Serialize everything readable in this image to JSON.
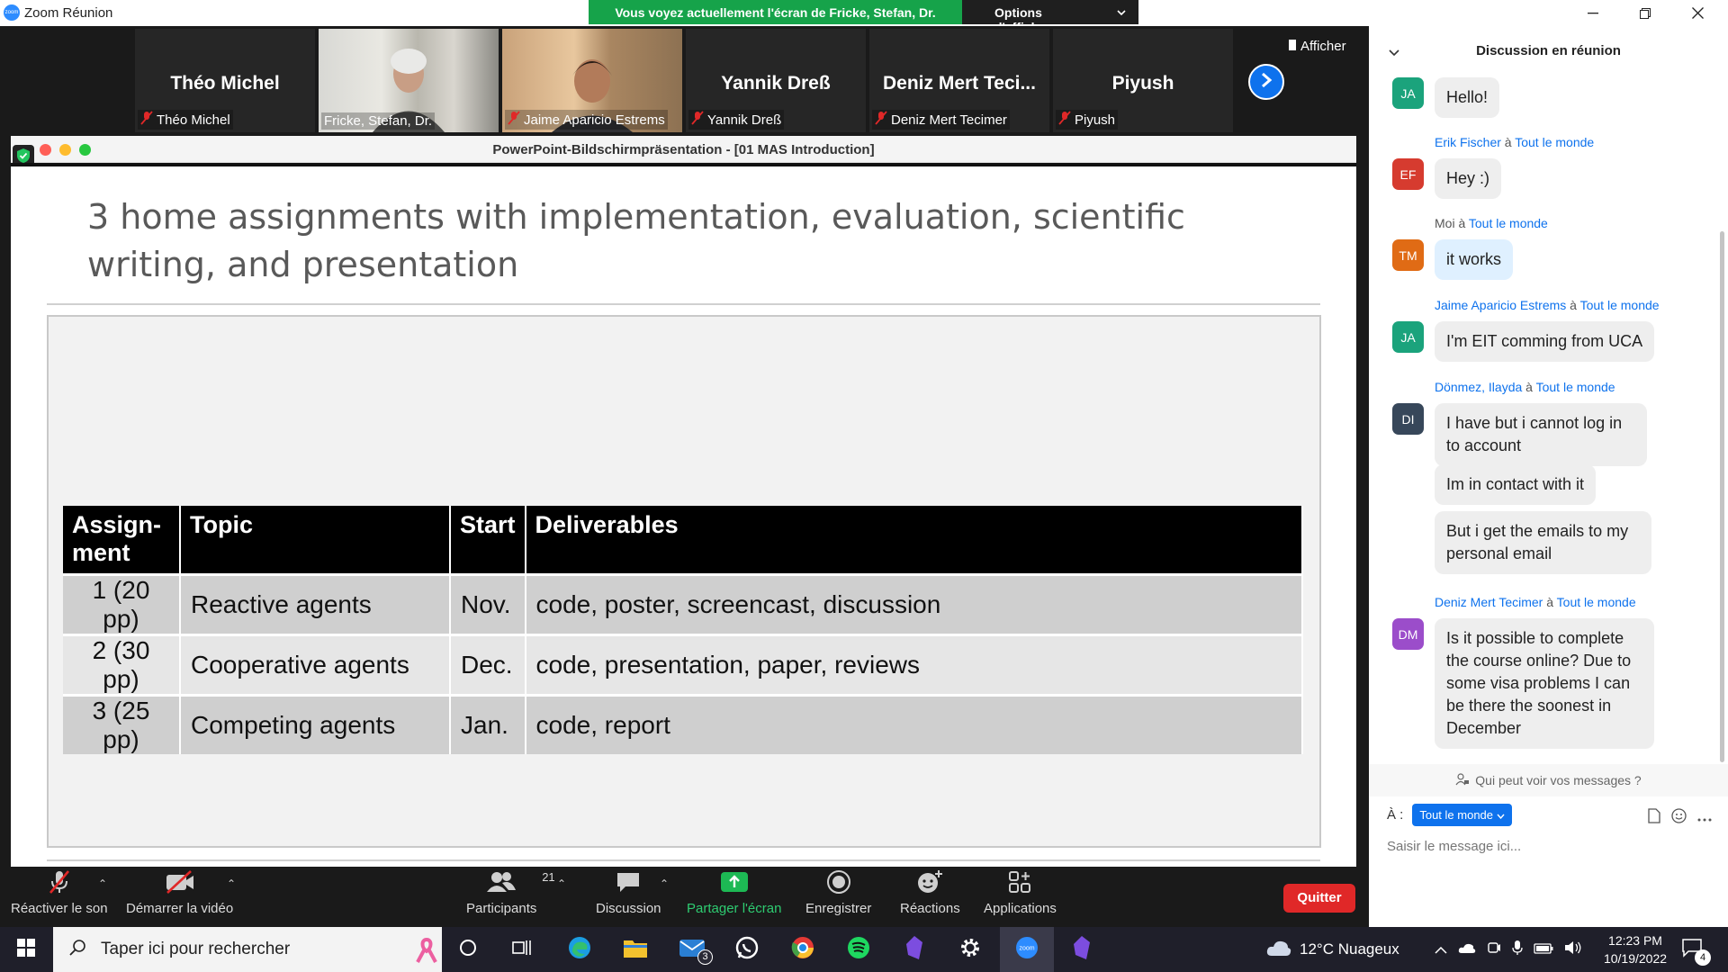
{
  "window": {
    "title": "Zoom Réunion"
  },
  "banner": {
    "viewing": "Vous voyez actuellement l'écran de Fricke, Stefan, Dr.",
    "options": "Options d'affichage"
  },
  "gallery": {
    "show_label": "Afficher",
    "participants": [
      {
        "big_name": "Théo Michel",
        "name": "Théo Michel",
        "muted": true,
        "video": false
      },
      {
        "big_name": "",
        "name": "Fricke, Stefan, Dr.",
        "muted": false,
        "video": true
      },
      {
        "big_name": "",
        "name": "Jaime Aparicio Estrems",
        "muted": true,
        "video": true
      },
      {
        "big_name": "Yannik Dreß",
        "name": "Yannik Dreß",
        "muted": true,
        "video": false
      },
      {
        "big_name": "Deniz Mert Teci...",
        "name": "Deniz Mert Tecimer",
        "muted": true,
        "video": false
      },
      {
        "big_name": "Piyush",
        "name": "Piyush",
        "muted": true,
        "video": false
      }
    ]
  },
  "share": {
    "window_title": "PowerPoint-Bildschirmpräsentation - [01 MAS Introduction]",
    "slide_title": "3 home assignments with implementation, evaluation, scientific writing, and presentation",
    "table": {
      "headers": [
        "Assign-\nment",
        "Topic",
        "Start",
        "Deliverables"
      ],
      "rows": [
        [
          "1 (20 pp)",
          "Reactive agents",
          "Nov.",
          "code, poster, screencast, discussion"
        ],
        [
          "2 (30 pp)",
          "Cooperative agents",
          "Dec.",
          "code, presentation, paper, reviews"
        ],
        [
          "3 (25 pp)",
          "Competing agents",
          "Jan.",
          "code, report"
        ]
      ]
    }
  },
  "toolbar": {
    "unmute": "Réactiver le son",
    "start_video": "Démarrer la vidéo",
    "participants": "Participants",
    "participants_count": "21",
    "chat": "Discussion",
    "share": "Partager l'écran",
    "record": "Enregistrer",
    "reactions": "Réactions",
    "apps": "Applications",
    "quit": "Quitter"
  },
  "chat": {
    "title": "Discussion en réunion",
    "messages": [
      {
        "initials": "JA",
        "color": "#1ba37c",
        "sender": "",
        "to": "",
        "bubbles": [
          "Hello!"
        ]
      },
      {
        "initials": "EF",
        "color": "#d63b2f",
        "sender": "Erik Fischer",
        "to": "Tout le monde",
        "bubbles": [
          "Hey :)"
        ]
      },
      {
        "initials": "TM",
        "color": "#e06b15",
        "sender": "Moi",
        "to": "Tout le monde",
        "bubbles": [
          "it works"
        ]
      },
      {
        "initials": "JA",
        "color": "#1ba37c",
        "sender": "Jaime Aparicio Estrems",
        "to": "Tout le monde",
        "bubbles": [
          "I'm EIT comming from UCA"
        ]
      },
      {
        "initials": "DI",
        "color": "#37475a",
        "sender": "Dönmez, Ilayda",
        "to": "Tout le monde",
        "bubbles": [
          "I have but i cannot log in to account",
          "Im in contact with it",
          "But i get the emails to my personal email"
        ]
      },
      {
        "initials": "DM",
        "color": "#9b4dca",
        "sender": "Deniz Mert Tecimer",
        "to": "Tout le monde",
        "bubbles": [
          "Is it possible to complete the course online? Due to some visa problems I can be there the soonest in December"
        ]
      }
    ],
    "to_word": "à",
    "privacy": "Qui peut voir vos messages ?",
    "to_label": "À :",
    "to_value": "Tout le monde",
    "placeholder": "Saisir le message ici..."
  },
  "taskbar": {
    "search_placeholder": "Taper ici pour rechercher",
    "mail_badge": "3",
    "weather": "12°C  Nuageux",
    "time": "12:23 PM",
    "date": "10/19/2022",
    "notif_count": "4"
  }
}
